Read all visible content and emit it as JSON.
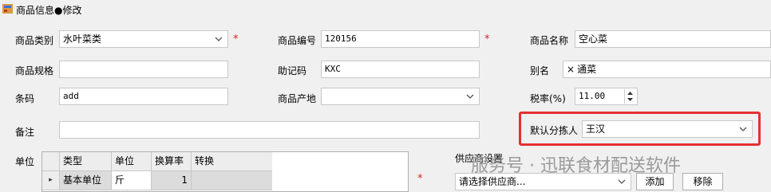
{
  "window": {
    "title": "商品信息●修改",
    "icon": "app-icon"
  },
  "form": {
    "category": {
      "label": "商品类别",
      "value": "水叶菜类",
      "required_mark": "*"
    },
    "code": {
      "label": "商品编号",
      "value": "120156",
      "required_mark": "*"
    },
    "name": {
      "label": "商品名称",
      "value": "空心菜"
    },
    "spec": {
      "label": "商品规格",
      "value": ""
    },
    "mnemonic": {
      "label": "助记码",
      "value": "KXC"
    },
    "alias": {
      "label": "别名",
      "tag": "通菜",
      "remove_glyph": "×"
    },
    "barcode": {
      "label": "条码",
      "value": "add"
    },
    "origin": {
      "label": "商品产地",
      "value": ""
    },
    "tax": {
      "label": "税率(%)",
      "value": "11.00"
    },
    "remark": {
      "label": "备注",
      "value": ""
    },
    "picker": {
      "label": "默认分拣人",
      "value": "王汉"
    }
  },
  "units": {
    "label": "单位",
    "columns": [
      "类型",
      "单位",
      "换算率",
      "转换"
    ],
    "rows": [
      {
        "type": "基本单位",
        "unit": "斤",
        "rate": "1",
        "convert": ""
      }
    ],
    "row_indicator": "▸",
    "required_mark": "*"
  },
  "supplier": {
    "label": "供应商设置",
    "placeholder": "请选择供应商...",
    "add_button": "添加",
    "remove_button": "移除"
  },
  "watermark": "服务号 · 迅联食材配送软件",
  "colors": {
    "highlight_border": "#e53030",
    "required": "#e02020",
    "background": "#f0f0f0"
  }
}
